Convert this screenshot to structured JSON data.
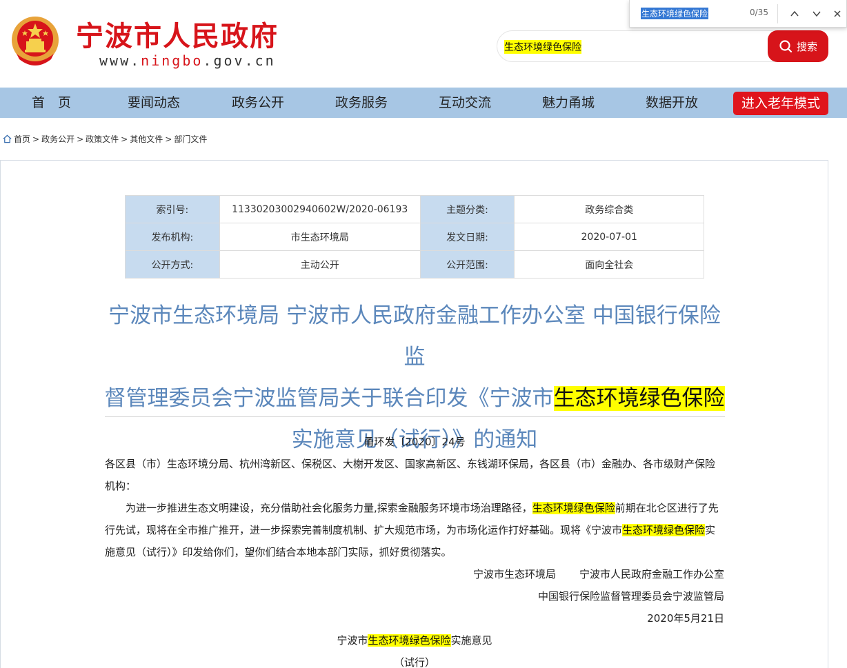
{
  "header": {
    "site_title": "宁波市人民政府",
    "site_url_prefix": "www.",
    "site_url_brand": "ningbo",
    "site_url_suffix": ".gov.cn",
    "search_value": "生态环境绿色保险",
    "search_button": "搜索"
  },
  "findbar": {
    "query": "生态环境绿色保险",
    "count": "0/35"
  },
  "nav": {
    "items": [
      "首　页",
      "要闻动态",
      "政务公开",
      "政务服务",
      "互动交流",
      "魅力甬城",
      "数据开放"
    ],
    "elder_mode": "进入老年模式"
  },
  "breadcrumb": {
    "items": [
      "首页",
      "政务公开",
      "政策文件",
      "其他文件",
      "部门文件"
    ],
    "separator": ">"
  },
  "meta": {
    "rows": [
      {
        "k1": "索引号:",
        "v1": "11330203002940602W/2020-06193",
        "k2": "主题分类:",
        "v2": "政务综合类"
      },
      {
        "k1": "发布机构:",
        "v1": "市生态环境局",
        "k2": "发文日期:",
        "v2": "2020-07-01"
      },
      {
        "k1": "公开方式:",
        "v1": "主动公开",
        "k2": "公开范围:",
        "v2": "面向全社会"
      }
    ]
  },
  "doc": {
    "title_line1": "宁波市生态环境局 宁波市人民政府金融工作办公室 中国银行保险监",
    "title_line2_a": "督管理委员会宁波监管局关于联合印发《宁波市",
    "title_line2_hl": "生态环境绿色保险",
    "title_line3": "实施意见（试行）》的通知",
    "doc_number": "甬环发〔2020〕24号",
    "recipients": "各区县（市）生态环境分局、杭州湾新区、保税区、大榭开发区、国家高新区、东钱湖环保局，各区县（市）金融办、各市级财产保险机构：",
    "para_a": "为进一步推进生态文明建设，充分借助社会化服务力量,探索金融服务环境市场治理路径，",
    "para_hl1": "生态环境绿色保险",
    "para_b": "前期在北仑区进行了先行先试，现将在全市推广推开，进一步探索完善制度机制、扩大规范市场，为市场化运作打好基础。现将《宁波市",
    "para_hl2": "生态环境绿色保险",
    "para_c": "实施意见（试行）》印发给你们，望你们结合本地本部门实际，抓好贯彻落实。",
    "sign1_a": "宁波市生态环境局",
    "sign1_b": "宁波市人民政府金融工作办公室",
    "sign2": "中国银行保险监督管理委员会宁波监管局",
    "date": "2020年5月21日",
    "sub_a": "宁波市",
    "sub_hl": "生态环境绿色保险",
    "sub_b": "实施意见",
    "sub2": "（试行）"
  }
}
